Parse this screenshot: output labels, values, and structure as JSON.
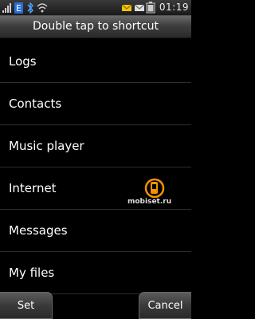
{
  "status_bar": {
    "time": "01:19",
    "icons": [
      "signal-icon",
      "e-network-icon",
      "bluetooth-icon",
      "wifi-icon",
      "message-icon",
      "mail-icon",
      "battery-icon"
    ]
  },
  "header": {
    "title": "Double tap to shortcut"
  },
  "list": {
    "items": [
      "Logs",
      "Contacts",
      "Music player",
      "Internet",
      "Messages",
      "My files"
    ]
  },
  "buttons": {
    "set": "Set",
    "cancel": "Cancel"
  },
  "watermark": {
    "text": "mobiset.ru"
  },
  "colors": {
    "accent": "#f39200"
  }
}
